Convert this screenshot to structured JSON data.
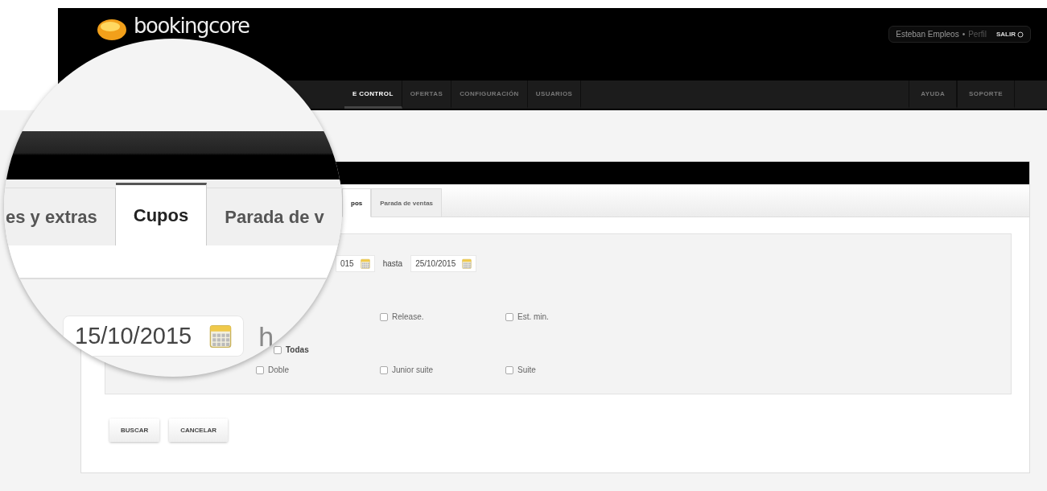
{
  "header": {
    "logo": "bookingcore",
    "user": {
      "name": "Esteban Empleos",
      "separator": "•",
      "profile_link": "Perfil",
      "logout": "SALIR"
    }
  },
  "nav": {
    "left": [
      {
        "label": "E CONTROL",
        "selected": true
      },
      {
        "label": "OFERTAS",
        "selected": false
      },
      {
        "label": "CONFIGURACIÓN",
        "selected": false
      },
      {
        "label": "USUARIOS",
        "selected": false
      }
    ],
    "right": [
      {
        "label": "AYUDA"
      },
      {
        "label": "SOPORTE"
      }
    ]
  },
  "tabs": [
    {
      "label": "pos",
      "selected": true
    },
    {
      "label": "Parada de ventas",
      "selected": false
    }
  ],
  "filters": {
    "date_from": "015",
    "until_label": "hasta",
    "date_to": "25/10/2015",
    "options": [
      {
        "label": "Release.",
        "checked": false
      },
      {
        "label": "Est. min.",
        "checked": false
      }
    ],
    "all_option": {
      "label": "Todas",
      "checked": false
    },
    "room_types": [
      {
        "label": "Doble",
        "checked": false
      },
      {
        "label": "Junior suite",
        "checked": false
      },
      {
        "label": "Suite",
        "checked": false
      }
    ]
  },
  "buttons": [
    "BUSCAR",
    "CANCELAR"
  ],
  "magnifier": {
    "tabs": [
      {
        "label": "es y extras",
        "selected": false
      },
      {
        "label": "Cupos",
        "selected": true
      },
      {
        "label": "Parada de v",
        "selected": false
      }
    ],
    "date": "15/10/2015",
    "label": "h"
  }
}
